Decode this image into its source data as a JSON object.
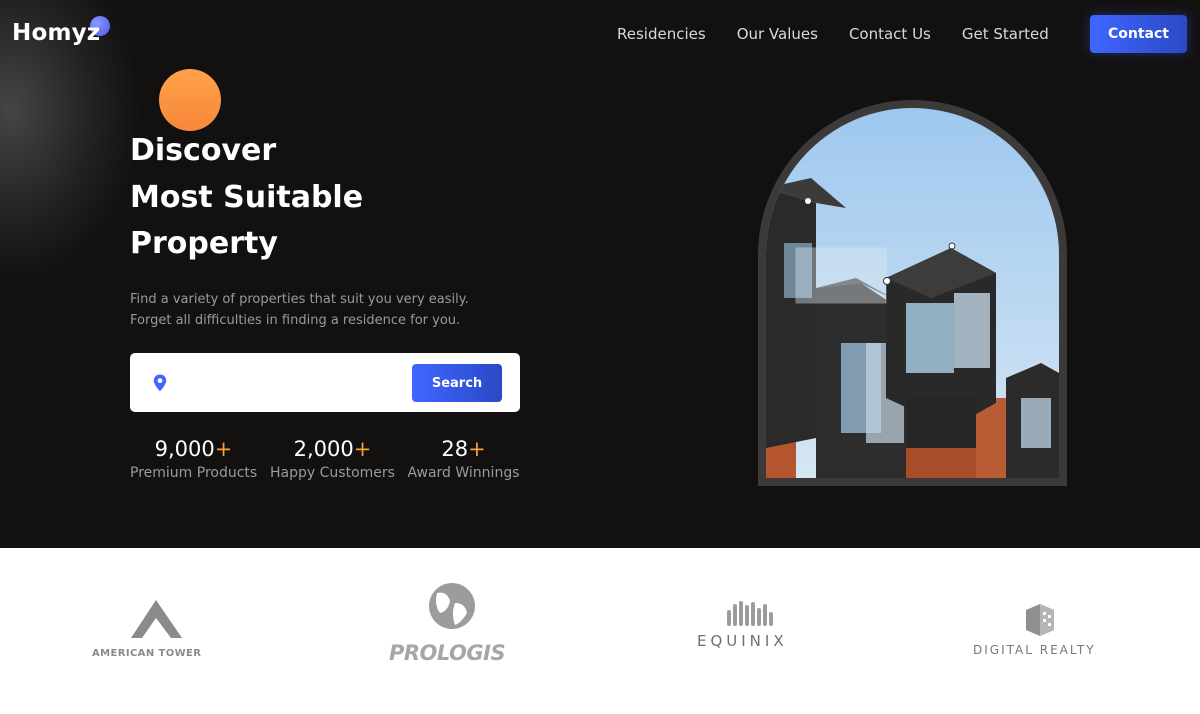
{
  "brand": {
    "name": "Homyz"
  },
  "nav": {
    "links": [
      "Residencies",
      "Our Values",
      "Contact Us",
      "Get Started"
    ],
    "contact_button": "Contact"
  },
  "hero": {
    "headline": [
      "Discover",
      "Most Suitable",
      "Property"
    ],
    "description": [
      "Find a variety of properties that suit you very easily.",
      "Forget all difficulties in finding a residence for you."
    ],
    "search": {
      "placeholder": "",
      "button": "Search"
    },
    "stats": [
      {
        "value": "9,000",
        "suffix": "+",
        "label": "Premium Products"
      },
      {
        "value": "2,000",
        "suffix": "+",
        "label": "Happy Customers"
      },
      {
        "value": "28",
        "suffix": "+",
        "label": "Award Winnings"
      }
    ]
  },
  "partners": [
    "AMERICAN TOWER",
    "PROLOGIS",
    "EQUINIX",
    "DIGITAL REALTY"
  ],
  "colors": {
    "accent": "#4066ff",
    "orange": "#f7883a",
    "hero_bg": "#131110"
  },
  "icons": {
    "search_location": "location-pin-icon"
  }
}
